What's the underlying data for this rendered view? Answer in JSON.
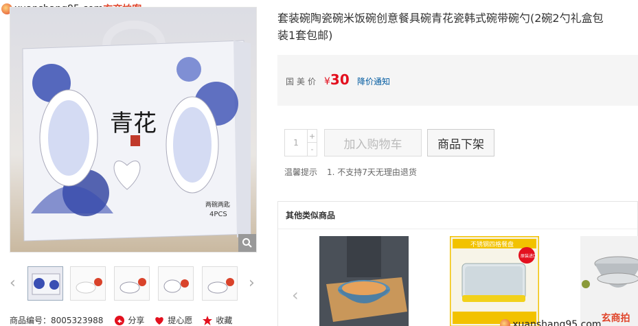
{
  "watermark": {
    "site": "xuanshang95.com",
    "brand": "玄商拍客"
  },
  "product": {
    "title": "套装碗陶瓷碗米饭碗创意餐具碗青花瓷韩式碗带碗勺(2碗2勺礼盒包装1套包邮)",
    "image_text": {
      "calligraphy": "青花",
      "sub": "两碗两匙",
      "pcs": "4PCS"
    }
  },
  "price": {
    "label": "国美价",
    "currency": "¥",
    "value": "30",
    "notify": "降价通知"
  },
  "purchase": {
    "quantity": "1",
    "plus": "+",
    "minus": "-",
    "add_to_cart": "加入购物车",
    "off_shelf": "商品下架"
  },
  "tips": {
    "label": "温馨提示",
    "item": "1. 不支持7天无理由退货"
  },
  "meta": {
    "sku": "商品编号：8005323988",
    "share": "分享",
    "wish": "提心愿",
    "fav": "收藏"
  },
  "similar": {
    "heading": "其他类似商品",
    "item2_text": "不锈钢四格餐盘",
    "item2_tag": "原装进口"
  },
  "colors": {
    "price": "#e3101e",
    "link": "#005aa0",
    "porcelain_blue": "#2c3f9e"
  }
}
